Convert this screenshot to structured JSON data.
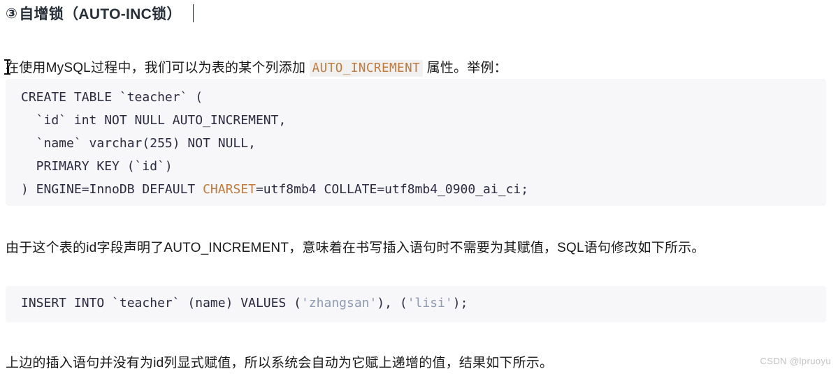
{
  "heading": {
    "marker": "③",
    "text": "自增锁（AUTO-INC锁）"
  },
  "paragraphs": {
    "intro_before": "在使用MySQL过程中，我们可以为表的某个列添加 ",
    "intro_code": "AUTO_INCREMENT",
    "intro_after": " 属性。举例：",
    "middle": "由于这个表的id字段声明了AUTO_INCREMENT，意味着在书写插入语句时不需要为其赋值，SQL语句修改如下所示。",
    "last": "上边的插入语句并没有为id列显式赋值，所以系统会自动为它赋上递增的值，结果如下所示。"
  },
  "code_block_1": {
    "line1": "CREATE TABLE `teacher` (",
    "line2": "  `id` int NOT NULL AUTO_INCREMENT,",
    "line3": "  `name` varchar(255) NOT NULL,",
    "line4": "  PRIMARY KEY (`id`)",
    "line5_a": ") ENGINE=InnoDB DEFAULT ",
    "line5_kw": "CHARSET",
    "line5_b": "=utf8mb4 COLLATE=utf8mb4_0900_ai_ci;"
  },
  "code_block_2": {
    "seg_a": "INSERT INTO `teacher` (name) VALUES (",
    "seg_str1": "'zhangsan'",
    "seg_b": "), (",
    "seg_str2": "'lisi'",
    "seg_c": ");"
  },
  "watermark": {
    "text": "CSDN @lpruoyu"
  },
  "colors": {
    "heading": "#262e38",
    "body_text": "#1a1a1a",
    "code_bg": "#f7f6f8",
    "code_text": "#2b2b42",
    "keyword_orange": "#c07a3e",
    "string_blue": "#8e9cb3",
    "inline_code_bg": "#f1f1f1",
    "watermark": "#c2c2c2"
  }
}
